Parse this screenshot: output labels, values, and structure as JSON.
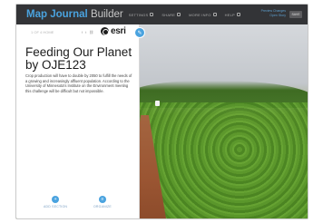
{
  "app": {
    "title_primary": "Map Journal",
    "title_secondary": "Builder"
  },
  "toolbar": {
    "items": [
      {
        "label": "SETTINGS",
        "icon": "pencil-icon"
      },
      {
        "label": "SHARE",
        "icon": "share-icon"
      },
      {
        "label": "MORE INFO",
        "icon": "info-icon"
      },
      {
        "label": "HELP",
        "icon": "help-icon"
      }
    ],
    "right_links": [
      "Preview Changes",
      "Open Story"
    ],
    "save_label": "SAVE"
  },
  "panel": {
    "section_tag": "1 OF 4 HOME",
    "share_icons": [
      "facebook-icon",
      "twitter-icon",
      "link-icon"
    ],
    "logo_text": "esri",
    "title": "Feeding Our Planet by OJE123",
    "body": "Crop production will have to double by 2050 to fulfill the needs of a growing and increasingly affluent population. According to the University of Minnesota's Institute on the Environment meeting this challenge will be difficult but not impossible.",
    "footer": {
      "add_section": "ADD SECTION",
      "organize": "ORGANIZE"
    }
  },
  "colors": {
    "accent": "#4aa3df",
    "topbar": "#333437",
    "panel": "#ffffff"
  }
}
